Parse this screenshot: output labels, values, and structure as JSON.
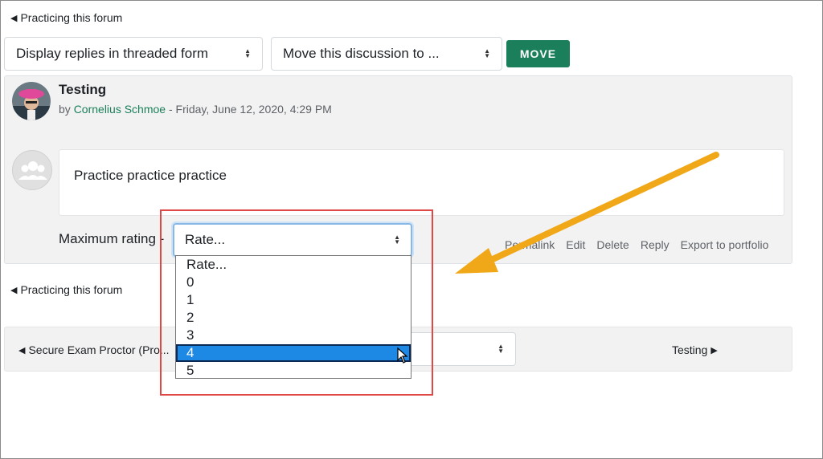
{
  "top_nav": {
    "back_label": "Practicing this forum"
  },
  "controls": {
    "display_mode": "Display replies in threaded form",
    "move_discussion": "Move this discussion to ...",
    "move_button": "MOVE"
  },
  "post": {
    "title": "Testing",
    "by_prefix": "by",
    "author": "Cornelius Schmoe",
    "date_sep": " - ",
    "date": "Friday, June 12, 2020, 4:29 PM",
    "content": "Practice practice practice",
    "rating_label": "Maximum rating",
    "rating_dash": "-",
    "rating_selected": "Rate...",
    "rating_options": [
      "Rate...",
      "0",
      "1",
      "2",
      "3",
      "4",
      "5"
    ],
    "actions": {
      "permalink": "Permalink",
      "edit": "Edit",
      "delete": "Delete",
      "reply": "Reply",
      "export": "Export to portfolio"
    }
  },
  "bottom_nav": {
    "back_label": "Practicing this forum",
    "prev_label": "Secure Exam Proctor (Pro...",
    "next_label": "Testing"
  },
  "colors": {
    "accent": "#1a7f5a",
    "selected_option": "#1e88e5",
    "highlight_border": "#e04848",
    "arrow": "#f0a818"
  }
}
